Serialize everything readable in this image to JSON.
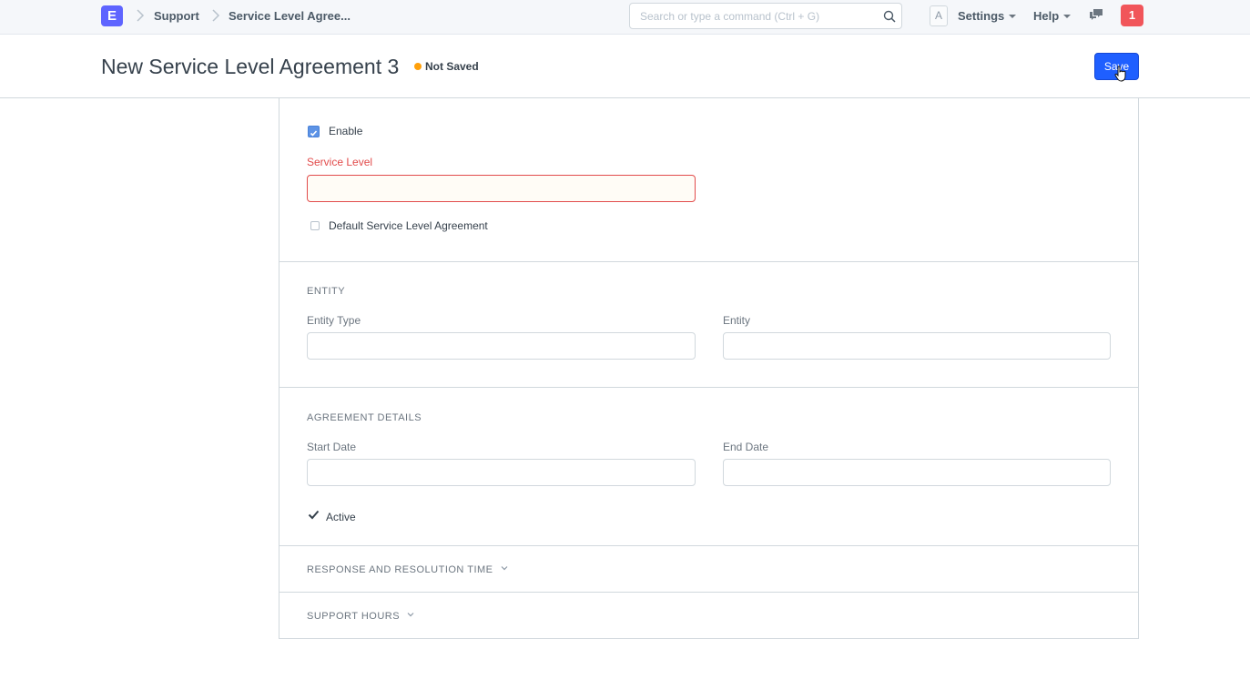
{
  "navbar": {
    "logo_letter": "E",
    "breadcrumbs": [
      "Support",
      "Service Level Agree..."
    ],
    "search_placeholder": "Search or type a command (Ctrl + G)",
    "avatar_letter": "A",
    "settings_label": "Settings",
    "help_label": "Help",
    "notification_count": "1"
  },
  "page": {
    "title": "New Service Level Agreement 3",
    "status": "Not Saved",
    "save_label": "Save"
  },
  "form": {
    "enable_label": "Enable",
    "enable_checked": true,
    "service_level_label": "Service Level",
    "service_level_value": "",
    "default_sla_label": "Default Service Level Agreement",
    "default_sla_checked": false,
    "entity_section": {
      "title": "ENTITY",
      "entity_type_label": "Entity Type",
      "entity_type_value": "",
      "entity_label": "Entity",
      "entity_value": ""
    },
    "agreement_section": {
      "title": "AGREEMENT DETAILS",
      "start_date_label": "Start Date",
      "start_date_value": "",
      "end_date_label": "End Date",
      "end_date_value": "",
      "active_label": "Active",
      "active_checked": true
    },
    "response_section": {
      "title": "RESPONSE AND RESOLUTION TIME",
      "collapsed": true
    },
    "support_hours_section": {
      "title": "SUPPORT HOURS",
      "collapsed": true
    }
  },
  "colors": {
    "primary": "#1f5fff",
    "logo": "#5e64ff",
    "error": "#e24c4c",
    "not_saved_dot": "#ffa00a",
    "notification": "#f1555a"
  }
}
